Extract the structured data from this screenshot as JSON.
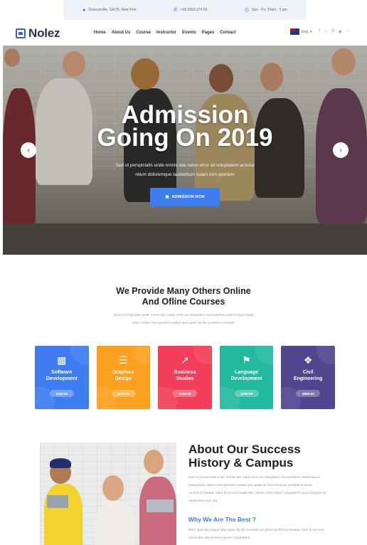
{
  "topbar": {
    "address": "Dawsonville, GA 35, New York",
    "phone": "+96.6952.374 56",
    "hours": "Sun - Fri, 10am - 5 pm",
    "icons": [
      "map-pin-icon",
      "phone-icon",
      "clock-icon"
    ]
  },
  "nav": {
    "logo": "Nolez",
    "menu": [
      "Home",
      "About Us",
      "Course",
      "Instructor",
      "Events",
      "Pages",
      "Contact"
    ],
    "language": "Eng",
    "social_icons": [
      "facebook-icon",
      "twitter-icon",
      "behance-icon",
      "youtube-icon",
      "dribbble-icon"
    ]
  },
  "hero": {
    "title_line1": "Admission",
    "title_line2": "Going On 2019",
    "subtitle_line1": "Sed ut perspiciatis unde omnis iste natus error sit voluptatem accusa",
    "subtitle_line2": "ntium doloremque laudantium totam rem aperiam",
    "button": "ADMISSION NOW",
    "prev": "‹",
    "next": "›"
  },
  "courses": {
    "title_line1": "We Provide Many Others Online",
    "title_line2": "And Ofline Courses",
    "desc_line1": "Sed ut perspiciatis unde omnis iste natus error sit voluptatem accusantium doloremque lauda",
    "desc_line2": "ntium totam rem aperiam eaque ipsa quae ab illo inventore veritatis",
    "items": [
      {
        "line1": "Software",
        "line2": "Development",
        "price": "$490.00",
        "color": "#3d7df0",
        "icon": "code-icon"
      },
      {
        "line1": "Graphics",
        "line2": "Design",
        "price": "$344.00",
        "color": "#fba01f",
        "icon": "layers-icon"
      },
      {
        "line1": "Business",
        "line2": "Studies",
        "price": "$460.00",
        "color": "#f23e5a",
        "icon": "chart-icon"
      },
      {
        "line1": "Language",
        "line2": "Development",
        "price": "$260.00",
        "color": "#22b9a0",
        "icon": "flag-icon"
      },
      {
        "line1": "Civil",
        "line2": "Engineering",
        "price": "$590.00",
        "color": "#4f468f",
        "icon": "cubes-icon"
      }
    ]
  },
  "about": {
    "title_line1": "About Our Success",
    "title_line2": "History & Campus",
    "text": "Sed ut perspiciatis unde omnis iste natus error sit voluptatem accusantium doloremque laudantium, totam rem aperiam eaque ipsa quae ab illo inventore veritatis et quasi architecto beatae vitae dicta sunt explicabo. Nemo enim ipsam voluptatem quia voluptas sit aspernatur aut odit",
    "why_title": "Why We Are The Best ?",
    "why_text": "Rem aperiam eaque ipsa quae ab illo inventore et quasi architecto beatae vitae dicta sunt explicabo. Nemo enim ipsam voluptatem"
  }
}
